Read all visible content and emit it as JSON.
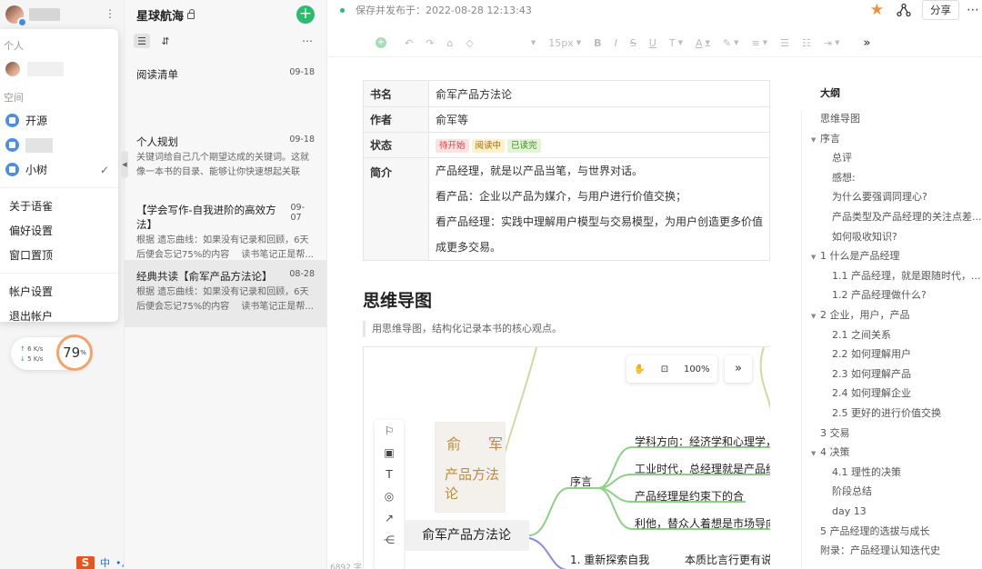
{
  "sidebar": {
    "popup": {
      "personal_label": "个人",
      "space_label": "空间",
      "spaces": [
        "开源",
        "小树"
      ],
      "menu": [
        "关于语雀",
        "偏好设置",
        "窗口置顶"
      ],
      "account": [
        "帐户设置",
        "退出帐户"
      ]
    },
    "speed": {
      "up": "6",
      "down": "5",
      "unit": "K/s",
      "percent": "79",
      "percent_unit": "%"
    },
    "ime": {
      "logo": "S",
      "lang": "中"
    }
  },
  "notelist": {
    "title": "星球航海",
    "notes": [
      {
        "title": "阅读清单",
        "date": "09-18",
        "snippet": ""
      },
      {
        "title": "个人规划",
        "date": "09-18",
        "snippet": "关键词给自己几个期望达成的关键词。这就像一本书的目录、能够让你快速想起关联的..."
      },
      {
        "title": "【学会写作-自我进阶的高效方法】",
        "date": "09-07",
        "snippet": "根据 遗忘曲线：如果没有记录和回顾，6天后便会忘记75%的内容　 读书笔记正是帮..."
      },
      {
        "title": "经典共读【俞军产品方法论】",
        "date": "08-28",
        "snippet": "根据 遗忘曲线：如果没有记录和回顾，6天后便会忘记75%的内容　 读书笔记正是帮..."
      }
    ]
  },
  "editor": {
    "status": "保存并发布于：2022-08-28 12:13:43",
    "share_label": "分享",
    "font_size": "15px",
    "table": {
      "rows": [
        {
          "key": "书名",
          "value": "俞军产品方法论"
        },
        {
          "key": "作者",
          "value": "俞军等"
        },
        {
          "key": "状态"
        },
        {
          "key": "简介"
        }
      ],
      "tags": [
        {
          "label": "待开始",
          "bg": "#fde2e2",
          "fg": "#d84040"
        },
        {
          "label": "阅读中",
          "bg": "#fdf2cc",
          "fg": "#a26b00"
        },
        {
          "label": "已读完",
          "bg": "#e1f5d6",
          "fg": "#3d8a1e"
        }
      ],
      "intro": [
        "产品经理，就是以产品当笔，与世界对话。",
        "看产品：企业以产品为媒介，与用户进行价值交换；",
        "看产品经理：实践中理解用户模型与交易模型，为用户创造更多价值，为企",
        "成更多交易。"
      ]
    },
    "mindmap_heading": "思维导图",
    "mindmap_desc": "用思维导图，结构化记录本书的核心观点。",
    "mindmap": {
      "zoom": "100%",
      "root": "俞军产品方法论",
      "branch": "序言",
      "leaves": [
        "学科方向：经济学和心理学，逐",
        "工业时代，总经理就是产品经理",
        "产品经理是约束下的合",
        "利他，替众人着想是市场导向型"
      ],
      "branch2": "1. 重新探索自我",
      "leaf2": "本质比言行更有说服",
      "book_title_1": "俞",
      "book_title_2": "军",
      "book_title_3": "产品方法论"
    },
    "word_count": "6892 字"
  },
  "outline": {
    "title": "大纲",
    "items": [
      {
        "label": "思维导图",
        "level": 0,
        "arrow": false
      },
      {
        "label": "序言",
        "level": 0,
        "arrow": true
      },
      {
        "label": "总评",
        "level": 1,
        "arrow": false
      },
      {
        "label": "感想:",
        "level": 1,
        "arrow": false
      },
      {
        "label": "为什么要强调同理心?",
        "level": 1,
        "arrow": false
      },
      {
        "label": "产品类型及产品经理的关注点差...",
        "level": 1,
        "arrow": false
      },
      {
        "label": "如何吸收知识?",
        "level": 1,
        "arrow": false
      },
      {
        "label": "1 什么是产品经理",
        "level": 0,
        "arrow": true
      },
      {
        "label": "1.1 产品经理，就是跟随时代，...",
        "level": 1,
        "arrow": false
      },
      {
        "label": "1.2 产品经理做什么?",
        "level": 1,
        "arrow": false
      },
      {
        "label": "2 企业，用户，产品",
        "level": 0,
        "arrow": true
      },
      {
        "label": "2.1 之间关系",
        "level": 1,
        "arrow": false
      },
      {
        "label": "2.2 如何理解用户",
        "level": 1,
        "arrow": false
      },
      {
        "label": "2.3 如何理解产品",
        "level": 1,
        "arrow": false
      },
      {
        "label": "2.4 如何理解企业",
        "level": 1,
        "arrow": false
      },
      {
        "label": "2.5 更好的进行价值交换",
        "level": 1,
        "arrow": false
      },
      {
        "label": "3 交易",
        "level": 0,
        "arrow": false
      },
      {
        "label": "4 决策",
        "level": 0,
        "arrow": true
      },
      {
        "label": "4.1 理性的决策",
        "level": 1,
        "arrow": false
      },
      {
        "label": "阶段总结",
        "level": 1,
        "arrow": false
      },
      {
        "label": "day 13",
        "level": 1,
        "arrow": false
      },
      {
        "label": "5 产品经理的选拔与成长",
        "level": 0,
        "arrow": false
      },
      {
        "label": "附录：产品经理认知迭代史",
        "level": 0,
        "arrow": false
      }
    ]
  },
  "colors": {
    "accent_green": "#2bbd6e",
    "star": "#f0903a",
    "mindmap_line": "#8ed08a"
  }
}
